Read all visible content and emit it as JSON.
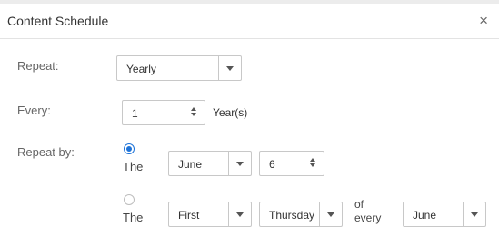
{
  "dialog": {
    "title": "Content Schedule",
    "close_glyph": "×"
  },
  "repeat": {
    "label": "Repeat:",
    "selected": "Yearly"
  },
  "every": {
    "label": "Every:",
    "value": "1",
    "unit": "Year(s)"
  },
  "repeat_by": {
    "label": "Repeat by:",
    "option1": {
      "checked": true,
      "label": "The",
      "month": "June",
      "day": "6"
    },
    "option2": {
      "checked": false,
      "label": "The",
      "ordinal": "First",
      "weekday": "Thursday",
      "of_line1": "of",
      "of_line2": "every",
      "month": "June"
    }
  },
  "colors": {
    "accent": "#1e73d8",
    "border": "#c8c8c8",
    "label": "#666666"
  }
}
